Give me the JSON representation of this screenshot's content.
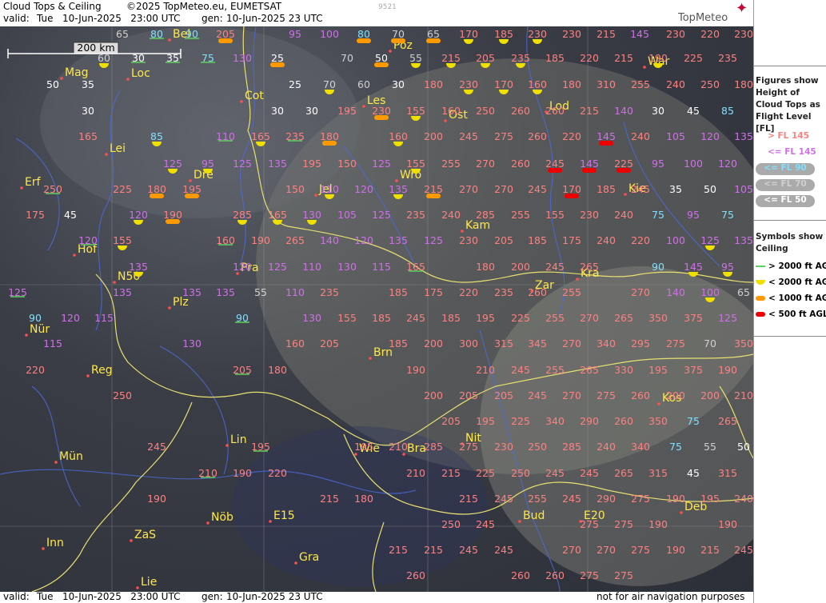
{
  "header": {
    "title": "Cloud Tops & Ceiling",
    "copyright": "©2025 TopMeteo.eu, EUMETSAT",
    "code": "9521",
    "valid_label": "valid:",
    "valid_time": "Tue   10-Jun-2025   23:00 UTC",
    "gen_label": "gen:",
    "gen_time": "10-Jun-2025 23 UTC",
    "logo": "TopMeteo"
  },
  "footer": {
    "valid_label": "valid:",
    "valid_time": "Tue   10-Jun-2025   23:00 UTC",
    "gen_label": "gen:",
    "gen_time": "10-Jun-2025 23 UTC",
    "disclaimer": "not for air navigation purposes"
  },
  "scale": "200 km",
  "legend": {
    "fl_title": "Figures show Height of Cloud Tops as Flight Level  [FL]",
    "fl_items": [
      {
        "label": "> FL 145",
        "color": "#ff8080"
      },
      {
        "label": "<= FL 145",
        "color": "#d070e8"
      },
      {
        "label": "<= FL 90",
        "color": "#7fe0ff"
      },
      {
        "label": "<= FL 70",
        "color": "#d0d0d0"
      },
      {
        "label": "<= FL 50",
        "color": "#ffffff"
      }
    ],
    "sym_title": "Symbols show Ceiling",
    "sym_items": [
      {
        "label": "> 2000 ft AGL",
        "color": "#60d060"
      },
      {
        "label": "< 2000 ft AGL",
        "color": "#f0e000"
      },
      {
        "label": "< 1000 ft AGL",
        "color": "#ff9900"
      },
      {
        "label": "< 500 ft AGL",
        "color": "#ee0000"
      }
    ]
  },
  "cities": [
    "Bel",
    "Poz",
    "Mag",
    "Loc",
    "War",
    "Cot",
    "Les",
    "Ost",
    "Lod",
    "Lei",
    "Wro",
    "Dre",
    "Erf",
    "Jel",
    "Kie",
    "Kam",
    "Hof",
    "N50",
    "Pra",
    "Kra",
    "Zar",
    "Plz",
    "Nür",
    "Brn",
    "Reg",
    "Kos",
    "Nit",
    "Lin",
    "Bra",
    "Wie",
    "Mün",
    "Nöb",
    "E15",
    "Bud",
    "Deb",
    "E20",
    "Inn",
    "ZaS",
    "Gra",
    "Lie"
  ],
  "values": [
    "65",
    "80",
    "90",
    "205",
    "95",
    "100",
    "80",
    "70",
    "65",
    "170",
    "185",
    "230",
    "230",
    "215",
    "145",
    "230",
    "220",
    "230",
    "60",
    "30",
    "35",
    "75",
    "130",
    "25",
    "70",
    "50",
    "55",
    "215",
    "205",
    "235",
    "185",
    "220",
    "215",
    "190",
    "225",
    "235",
    "50",
    "35",
    "25",
    "70",
    "60",
    "30",
    "180",
    "230",
    "170",
    "160",
    "180",
    "310",
    "255",
    "240",
    "250",
    "180",
    "30",
    "30",
    "30",
    "195",
    "230",
    "155",
    "160",
    "250",
    "260",
    "260",
    "215",
    "140",
    "30",
    "45",
    "85",
    "165",
    "85",
    "110",
    "165",
    "235",
    "180",
    "160",
    "200",
    "245",
    "275",
    "260",
    "220",
    "145",
    "240",
    "105",
    "120",
    "135",
    "125",
    "95",
    "125",
    "135",
    "195",
    "150",
    "125",
    "155",
    "255",
    "270",
    "260",
    "245",
    "145",
    "225",
    "95",
    "100",
    "120",
    "250",
    "225",
    "180",
    "195",
    "150",
    "110",
    "120",
    "135",
    "215",
    "270",
    "270",
    "245",
    "170",
    "185",
    "245",
    "35",
    "50",
    "105",
    "175",
    "45",
    "120",
    "190",
    "285",
    "165",
    "130",
    "105",
    "125",
    "235",
    "240",
    "285",
    "255",
    "155",
    "230",
    "240",
    "75",
    "95",
    "75",
    "120",
    "155",
    "160",
    "190",
    "265",
    "140",
    "120",
    "135",
    "125",
    "230",
    "205",
    "185",
    "175",
    "240",
    "220",
    "100",
    "125",
    "135",
    "135",
    "120",
    "125",
    "110",
    "130",
    "115",
    "165",
    "180",
    "200",
    "245",
    "265",
    "90",
    "145",
    "95",
    "125",
    "135",
    "135",
    "135",
    "55",
    "110",
    "235",
    "185",
    "175",
    "220",
    "235",
    "260",
    "255",
    "270",
    "140",
    "100",
    "65",
    "90",
    "120",
    "115",
    "90",
    "130",
    "155",
    "185",
    "245",
    "185",
    "195",
    "225",
    "255",
    "270",
    "265",
    "350",
    "375",
    "125",
    "115",
    "130",
    "160",
    "205",
    "185",
    "200",
    "300",
    "315",
    "345",
    "270",
    "340",
    "295",
    "275",
    "70",
    "350",
    "220",
    "205",
    "180",
    "190",
    "210",
    "245",
    "255",
    "265",
    "330",
    "195",
    "375",
    "190",
    "250",
    "200",
    "205",
    "205",
    "245",
    "270",
    "275",
    "260",
    "200",
    "200",
    "210",
    "205",
    "195",
    "225",
    "340",
    "290",
    "260",
    "350",
    "75",
    "265",
    "245",
    "195",
    "195",
    "210",
    "285",
    "275",
    "230",
    "250",
    "285",
    "240",
    "340",
    "75",
    "55",
    "50",
    "210",
    "190",
    "220",
    "210",
    "215",
    "225",
    "250",
    "245",
    "245",
    "265",
    "315",
    "45",
    "315",
    "190",
    "215",
    "180",
    "215",
    "245",
    "255",
    "245",
    "290",
    "275",
    "190",
    "195",
    "240",
    "250",
    "245",
    "275",
    "275",
    "190",
    "190",
    "215",
    "215",
    "245",
    "245",
    "270",
    "270",
    "275",
    "190",
    "215",
    "245",
    "260",
    "260",
    "260",
    "275",
    "275"
  ]
}
